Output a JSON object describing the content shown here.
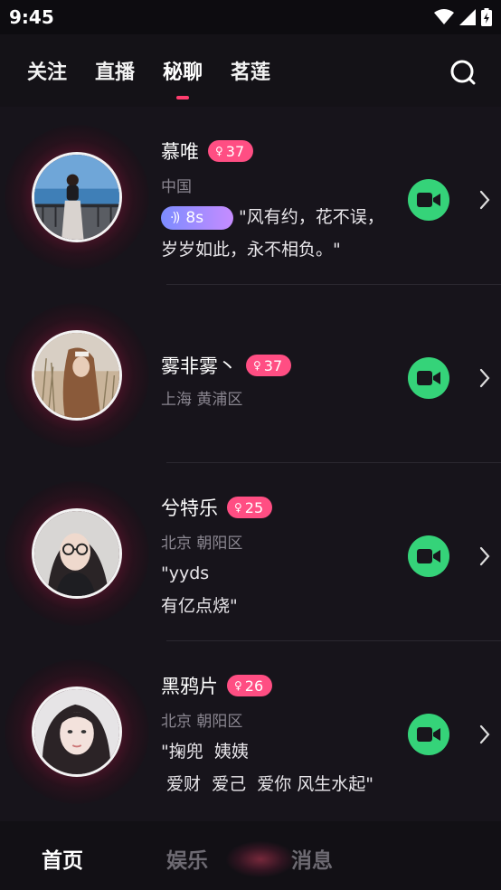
{
  "status_bar": {
    "time": "9:45"
  },
  "top_tabs": [
    {
      "label": "关注",
      "active": false
    },
    {
      "label": "直播",
      "active": false
    },
    {
      "label": "秘聊",
      "active": true
    },
    {
      "label": "茗莲",
      "active": false
    }
  ],
  "users": [
    {
      "name": "慕唯",
      "age": "37",
      "location": "中国",
      "voice_duration": "8s",
      "quote": "\"风有约，花不误，岁岁如此，永不相负。\""
    },
    {
      "name": "雾非雾丶",
      "age": "37",
      "location": "上海 黄浦区",
      "quote": ""
    },
    {
      "name": "兮特乐",
      "age": "25",
      "location": "北京 朝阳区",
      "quote": "\"yyds\n有亿点烧\""
    },
    {
      "name": "黑鸦片",
      "age": "26",
      "location": "北京 朝阳区",
      "quote": "\"掬兜  姨姨\n 爱财  爱己  爱你 风生水起\""
    }
  ],
  "bottom_tabs": [
    {
      "label": "首页",
      "active": true
    },
    {
      "label": "娱乐",
      "active": false
    },
    {
      "label": "消息",
      "active": false
    }
  ],
  "icons": {
    "search": "search-icon",
    "video": "video-camera-icon",
    "chevron": "chevron-right-icon",
    "gender": "female-icon"
  },
  "colors": {
    "accent": "#ff3d6e",
    "badge": "#ff4e83",
    "video_button": "#35d379",
    "voice_gradient_start": "#7c8cff",
    "voice_gradient_end": "#c68cff",
    "background": "#17141b"
  }
}
